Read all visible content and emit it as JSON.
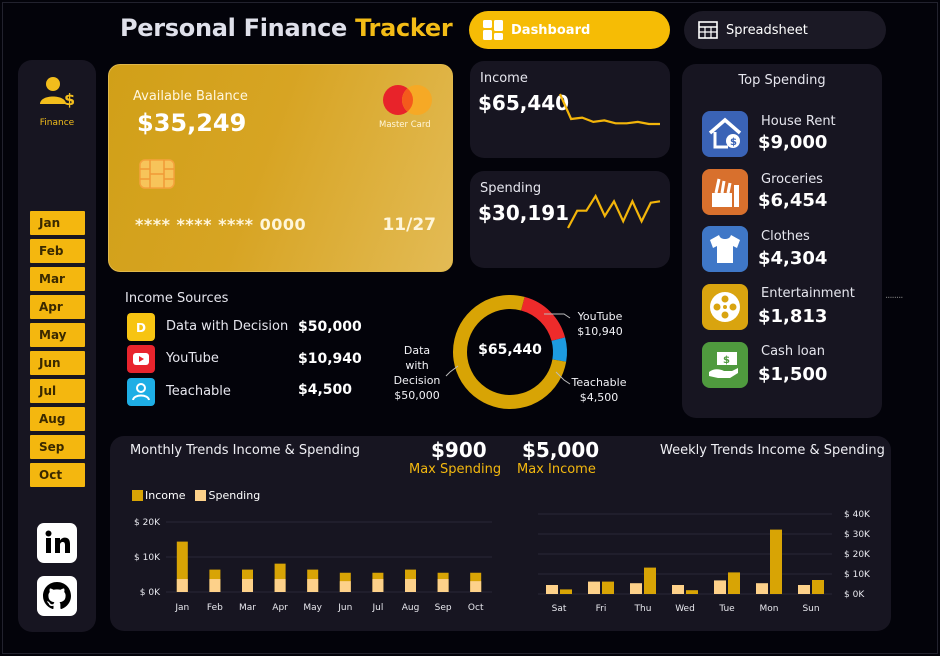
{
  "header": {
    "title_main": "Personal Finance",
    "title_accent": "Tracker",
    "tabs": [
      {
        "label": "Dashboard",
        "icon": "dashboard-grid-icon",
        "active": true
      },
      {
        "label": "Spreadsheet",
        "icon": "spreadsheet-table-icon",
        "active": false
      }
    ]
  },
  "sidebar": {
    "logo_label": "Finance",
    "months": [
      "Jan",
      "Feb",
      "Mar",
      "Apr",
      "May",
      "Jun",
      "Jul",
      "Aug",
      "Sep",
      "Oct"
    ],
    "social": [
      "linkedin-icon",
      "github-icon"
    ]
  },
  "card": {
    "label": "Available Balance",
    "balance": "$35,249",
    "brand": "Master Card",
    "number": "**** **** **** 0000",
    "expiry": "11/27"
  },
  "income": {
    "label": "Income",
    "value": "$65,440",
    "trend": [
      9,
      2,
      2.4,
      1.2,
      1.6,
      0.8,
      0.8,
      1.2,
      0.6,
      0.6
    ]
  },
  "spending": {
    "label": "Spending",
    "value": "$30,191",
    "trend": [
      1,
      3.6,
      3.6,
      5.8,
      2.8,
      5,
      2,
      5,
      2,
      4.8,
      5
    ]
  },
  "income_sources": {
    "title": "Income Sources",
    "items": [
      {
        "name": "Data with Decision",
        "value": "$50,000",
        "icon": "data-with-decision-logo-icon",
        "color": "#f7c412"
      },
      {
        "name": "YouTube",
        "value": "$10,940",
        "icon": "youtube-icon",
        "color": "#e8242d"
      },
      {
        "name": "Teachable",
        "value": "$4,500",
        "icon": "teachable-icon",
        "color": "#1eaee5"
      }
    ]
  },
  "donut": {
    "center": "$65,440",
    "segments": [
      {
        "name": "Data with Decision",
        "value": 50000,
        "label_lines": [
          "Data",
          "with",
          "Decision",
          "$50,000"
        ],
        "color": "#d8a405"
      },
      {
        "name": "YouTube",
        "value": 10940,
        "label_lines": [
          "YouTube",
          "$10,940"
        ],
        "color": "#ee2b2b"
      },
      {
        "name": "Teachable",
        "value": 4500,
        "label_lines": [
          "Teachable",
          "$4,500"
        ],
        "color": "#1d9be0"
      }
    ]
  },
  "top_spending": {
    "title": "Top Spending",
    "items": [
      {
        "name": "House Rent",
        "value": "$9,000",
        "icon": "house-rent-icon",
        "color": "#3a63b6"
      },
      {
        "name": "Groceries",
        "value": "$6,454",
        "icon": "groceries-icon",
        "color": "#d8702d"
      },
      {
        "name": "Clothes",
        "value": "$4,304",
        "icon": "tshirt-icon",
        "color": "#3f77c7"
      },
      {
        "name": "Entertainment",
        "value": "$1,813",
        "icon": "film-reel-icon",
        "color": "#d9a40f"
      },
      {
        "name": "Cash loan",
        "value": "$1,500",
        "icon": "cash-loan-icon",
        "color": "#4f9a3e"
      }
    ]
  },
  "trends": {
    "monthly_title": "Monthly Trends Income & Spending",
    "weekly_title": "Weekly Trends Income & Spending",
    "max_spending": {
      "value": "$900",
      "label": "Max Spending"
    },
    "max_income": {
      "value": "$5,000",
      "label": "Max Income"
    },
    "legend": {
      "income": "Income",
      "spending": "Spending",
      "income_color": "#d8a405",
      "spending_color": "#fdd18a"
    }
  },
  "chart_data": [
    {
      "type": "bar",
      "title": "Monthly Trends Income & Spending",
      "categories": [
        "Jan",
        "Feb",
        "Mar",
        "Apr",
        "May",
        "Jun",
        "Jul",
        "Aug",
        "Sep",
        "Oct"
      ],
      "series": [
        {
          "name": "Income",
          "values": [
            14400,
            6400,
            6400,
            8100,
            6400,
            5500,
            5500,
            6400,
            5500,
            5500
          ]
        },
        {
          "name": "Spending",
          "values": [
            3700,
            3700,
            3700,
            3700,
            3700,
            3100,
            3700,
            3700,
            3700,
            3100
          ]
        }
      ],
      "yticks": [
        "$ 0K",
        "$ 10K",
        "$ 20K"
      ],
      "ylim": [
        0,
        20000
      ]
    },
    {
      "type": "bar",
      "title": "Weekly Trends Income & Spending",
      "categories": [
        "Sat",
        "Fri",
        "Thu",
        "Wed",
        "Tue",
        "Mon",
        "Sun"
      ],
      "series": [
        {
          "name": "Spending",
          "values": [
            4500,
            6200,
            5400,
            4500,
            6800,
            5400,
            4500
          ]
        },
        {
          "name": "Income",
          "values": [
            2300,
            6200,
            13200,
            1900,
            10800,
            32200,
            7000
          ]
        }
      ],
      "yticks": [
        "$ 0K",
        "$ 10K",
        "$ 20K",
        "$ 30K",
        "$ 40K"
      ],
      "ylim": [
        0,
        40000
      ]
    }
  ]
}
